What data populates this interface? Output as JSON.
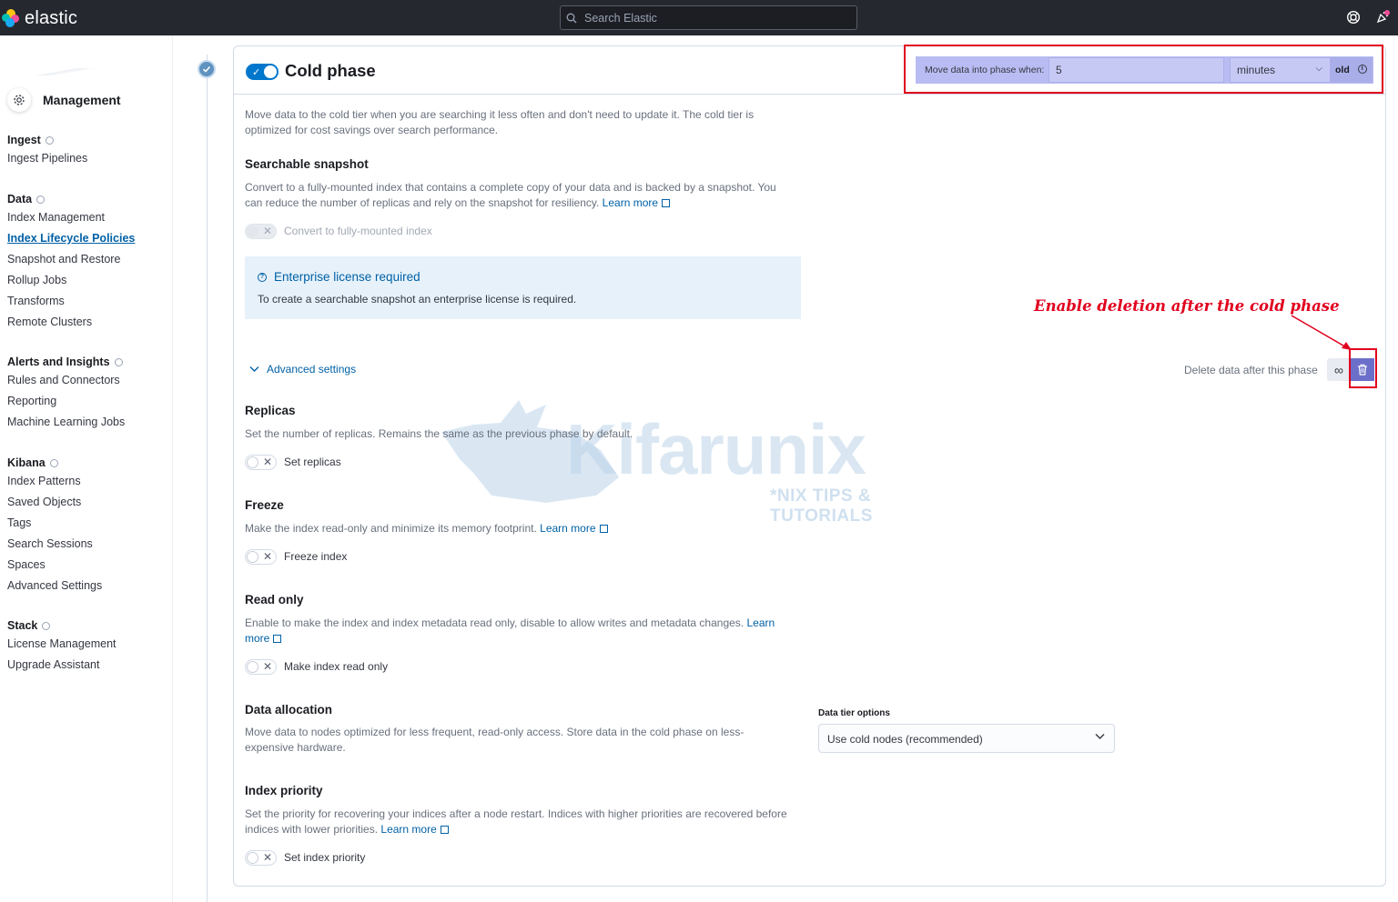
{
  "app": {
    "brand": "elastic"
  },
  "header": {
    "search_placeholder": "Search Elastic"
  },
  "sidebar": {
    "title": "Management",
    "groups": [
      {
        "label": "Ingest",
        "items": [
          "Ingest Pipelines"
        ]
      },
      {
        "label": "Data",
        "items": [
          "Index Management",
          "Index Lifecycle Policies",
          "Snapshot and Restore",
          "Rollup Jobs",
          "Transforms",
          "Remote Clusters"
        ]
      },
      {
        "label": "Alerts and Insights",
        "items": [
          "Rules and Connectors",
          "Reporting",
          "Machine Learning Jobs"
        ]
      },
      {
        "label": "Kibana",
        "items": [
          "Index Patterns",
          "Saved Objects",
          "Tags",
          "Search Sessions",
          "Spaces",
          "Advanced Settings"
        ]
      },
      {
        "label": "Stack",
        "items": [
          "License Management",
          "Upgrade Assistant"
        ]
      }
    ],
    "active_item": "Index Lifecycle Policies"
  },
  "phase": {
    "title": "Cold phase",
    "enabled": true,
    "move_label": "Move data into phase when:",
    "move_value": "5",
    "move_unit": "minutes",
    "move_suffix": "old",
    "description_line1": "Move data to the cold tier when you are searching it less often and don't need to update it. The cold tier is",
    "description_line2": "optimized for cost savings over search performance."
  },
  "searchable_snapshot": {
    "title": "Searchable snapshot",
    "desc_line1": "Convert to a fully-mounted index that contains a complete copy of your data and is backed by a snapshot. You",
    "desc_line2": "can reduce the number of replicas and rely on the snapshot for resiliency.",
    "learn_more": "Learn more",
    "toggle_label": "Convert to fully-mounted index"
  },
  "callout": {
    "title": "Enterprise license required",
    "text": "To create a searchable snapshot an enterprise license is required."
  },
  "advanced_settings_label": "Advanced settings",
  "annotation": "Enable deletion after the cold phase",
  "delete_label": "Delete data after this phase",
  "replicas": {
    "title": "Replicas",
    "desc": "Set the number of replicas. Remains the same as the previous phase by default.",
    "toggle_label": "Set replicas"
  },
  "freeze": {
    "title": "Freeze",
    "desc": "Make the index read-only and minimize its memory footprint.",
    "learn_more": "Learn more",
    "toggle_label": "Freeze index"
  },
  "read_only": {
    "title": "Read only",
    "desc_line1": "Enable to make the index and index metadata read only, disable to allow writes and metadata changes.",
    "learn_word1": "Learn",
    "learn_word2": "more",
    "toggle_label": "Make index read only"
  },
  "data_allocation": {
    "title": "Data allocation",
    "desc_line1": "Move data to nodes optimized for less frequent, read-only access. Store data in the cold phase on less-",
    "desc_line2": "expensive hardware.",
    "field_label": "Data tier options",
    "selected": "Use cold nodes (recommended)"
  },
  "index_priority": {
    "title": "Index priority",
    "desc_line1": "Set the priority for recovering your indices after a node restart. Indices with higher priorities are recovered before",
    "desc_line2": "indices with lower priorities.",
    "learn_more": "Learn more",
    "toggle_label": "Set index priority"
  },
  "watermark": {
    "main": "Kifarunix",
    "sub": "*NIX TIPS & TUTORIALS"
  },
  "colors": {
    "accent": "#0061a6",
    "annotation": "#e1001e",
    "header_bg": "#25282f",
    "highlight": "#b9bcf2"
  }
}
